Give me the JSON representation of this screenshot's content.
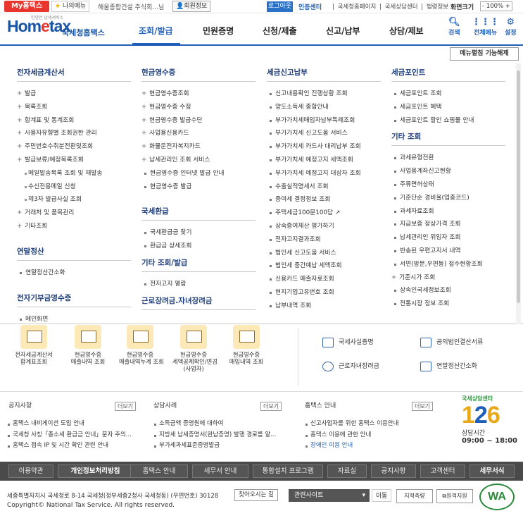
{
  "topbar": {
    "my_home": "My홈택스",
    "my_menu": "나의메뉴",
    "user": "해울종합건설 주식회...님",
    "user_info": "회원정보",
    "logout": "로그아웃",
    "cert_center": "인증센터",
    "links": [
      "국세청홈페이지",
      "국세상담센터",
      "법령정보"
    ],
    "screen_size": "화면크기",
    "zoom": "100%",
    "zoom_minus": "-",
    "zoom_plus": "+"
  },
  "header": {
    "logo_text_a": "Hom",
    "logo_text_e": "e",
    "logo_text_b": "tax",
    "logo_sub": "국세청홈택스",
    "logo_tag": "안녕은 납세서비스",
    "nav": [
      "조회/발급",
      "민원증명",
      "신청/제출",
      "신고/납부",
      "상담/제보"
    ],
    "active_nav": "조회/발급",
    "search": "검색",
    "all_menu": "전체메뉴",
    "settings": "설정"
  },
  "megamenu": {
    "unpin": "메뉴펼침 기능해제",
    "col1": {
      "cat1": "전자세금계산서",
      "items1": [
        "발급",
        "목록조회",
        "합계표 및 통계조회",
        "사용자유형별 조회권한 관리",
        "주민번호수취분전환및조회",
        "발급보류/예정목록조회"
      ],
      "sub1": [
        "메일발송목록 조회 및 재발송",
        "수신전용메일 신청",
        "제3자 발급사실 조회"
      ],
      "items1b": [
        "거래처 및 품목관리",
        "기타조회"
      ],
      "cat2": "연말정산",
      "items2": [
        "연말정산간소화"
      ],
      "cat3": "전자기부금영수증",
      "items3": [
        "메인화면"
      ]
    },
    "col2": {
      "cat1": "현금영수증",
      "items1": [
        "현금영수증조회",
        "현금영수증 수정",
        "현금영수증 발급수단",
        "사업용신용카드",
        "화물운전자복지카드",
        "납세관리인 조회 서비스"
      ],
      "items1b": [
        "현금영수증 인터넷 발급 안내",
        "현금영수증 발급"
      ],
      "cat2": "국세환급",
      "items2": [
        "국세환급금 찾기",
        "환급금 상세조회"
      ],
      "cat3": "기타 조회/발급",
      "items3": [
        "전자고지 열람"
      ],
      "cat4": "근로장려금.자녀장려금"
    },
    "col3": {
      "cat1": "세금신고납부",
      "items1": [
        "신고내용확인 진행상황 조회",
        "양도소득세 종합안내",
        "부가가치세매입자납부특례조회",
        "부가가치세 신고도움 서비스",
        "부가가치세 카드사 대리납부 조회",
        "부가가치세 예정고지 세액조회",
        "부가가치세 예정고지 대상자 조회",
        "수출실적명세서 조회",
        "증여세 결정정보 조회",
        "주택세금100문100답",
        "상속증여재산 평가하기",
        "전자고지결과조회",
        "법인세 신고도움 서비스",
        "법인세 중간예납 세액조회",
        "신용카드 매출자료조회",
        "현지기업고유번호 조회",
        "납부내역 조회"
      ]
    },
    "col4": {
      "cat1": "세금포인트",
      "items1": [
        "세금포인트 조회",
        "세금포인트 혜택",
        "세금포인트 할인 쇼핑몰 안내"
      ],
      "cat2": "기타 조회",
      "items2": [
        "과세유형전환",
        "사업용계좌신고현황",
        "주류면허상태",
        "기준단순 경비율(업종코드)",
        "과세자료조회",
        "지급보증 정상가격 조회",
        "납세관리인 위임자 조회",
        "반송된 우편고지서 내역",
        "서면(방문,우편등) 접수현황조회",
        "기준시가 조회",
        "상속인국세정보조회",
        "전통시장 정보 조회"
      ]
    }
  },
  "services": {
    "left": [
      [
        "전자세금계산서",
        "합계표조회"
      ],
      [
        "현금영수증",
        "매출내역 조회"
      ],
      [
        "현금영수증",
        "매출내역누계 조회"
      ],
      [
        "현금영수증",
        "세액공제확인/변경",
        "(사업자)"
      ],
      [
        "현금영수증",
        "매입내역 조회"
      ]
    ],
    "right": [
      "국세사실증명",
      "공익법인결산서류",
      "근로자녀장려금",
      "연말정산간소화"
    ]
  },
  "news": {
    "notice_title": "공지사항",
    "notice": [
      "홈택스 내비게이션 도입 안내",
      "국세청 사칭「종소세 환급금 안내」문자 주의...",
      "홈택스 접속 IP 및 시간 확인 관련 안내"
    ],
    "cases_title": "상담사례",
    "cases": [
      "소득금액 증명원에 대하여",
      "지방세 납세증명서(완납증명) 발행 경로를 알...",
      "부가세과세표준증명발급"
    ],
    "guide_title": "홈택스 안내",
    "guide": [
      "신고사업자를 위한 홈택스 이용안내",
      "홈택스 이용에 관한 안내",
      "장애인 이용 안내"
    ],
    "more": "더보기"
  },
  "callcenter": {
    "top": "국세상담센터",
    "num_a": "1",
    "num_b": "2",
    "num_c": "6",
    "hours_label": "상담시간",
    "hours": "09:00 ~ 18:00"
  },
  "footnav": [
    "이용약관",
    "개인정보처리방침",
    "홈택스 안내",
    "세무서 안내",
    "통합설치 프로그램",
    "자료실",
    "공지사항",
    "고객센터",
    "세무서식"
  ],
  "footer": {
    "address": "세종특별자치시 국세청로 8-14 국세청(정부세종2청사 국세청동) (우편번호) 30128",
    "find": "찾아오시는 길",
    "copyright": "Copyright© National Tax Service. All rights reserved.",
    "related": "관련사이트",
    "go": "이동",
    "btn1": "지적측량",
    "btn2": "원격지원",
    "wa": "WA"
  }
}
